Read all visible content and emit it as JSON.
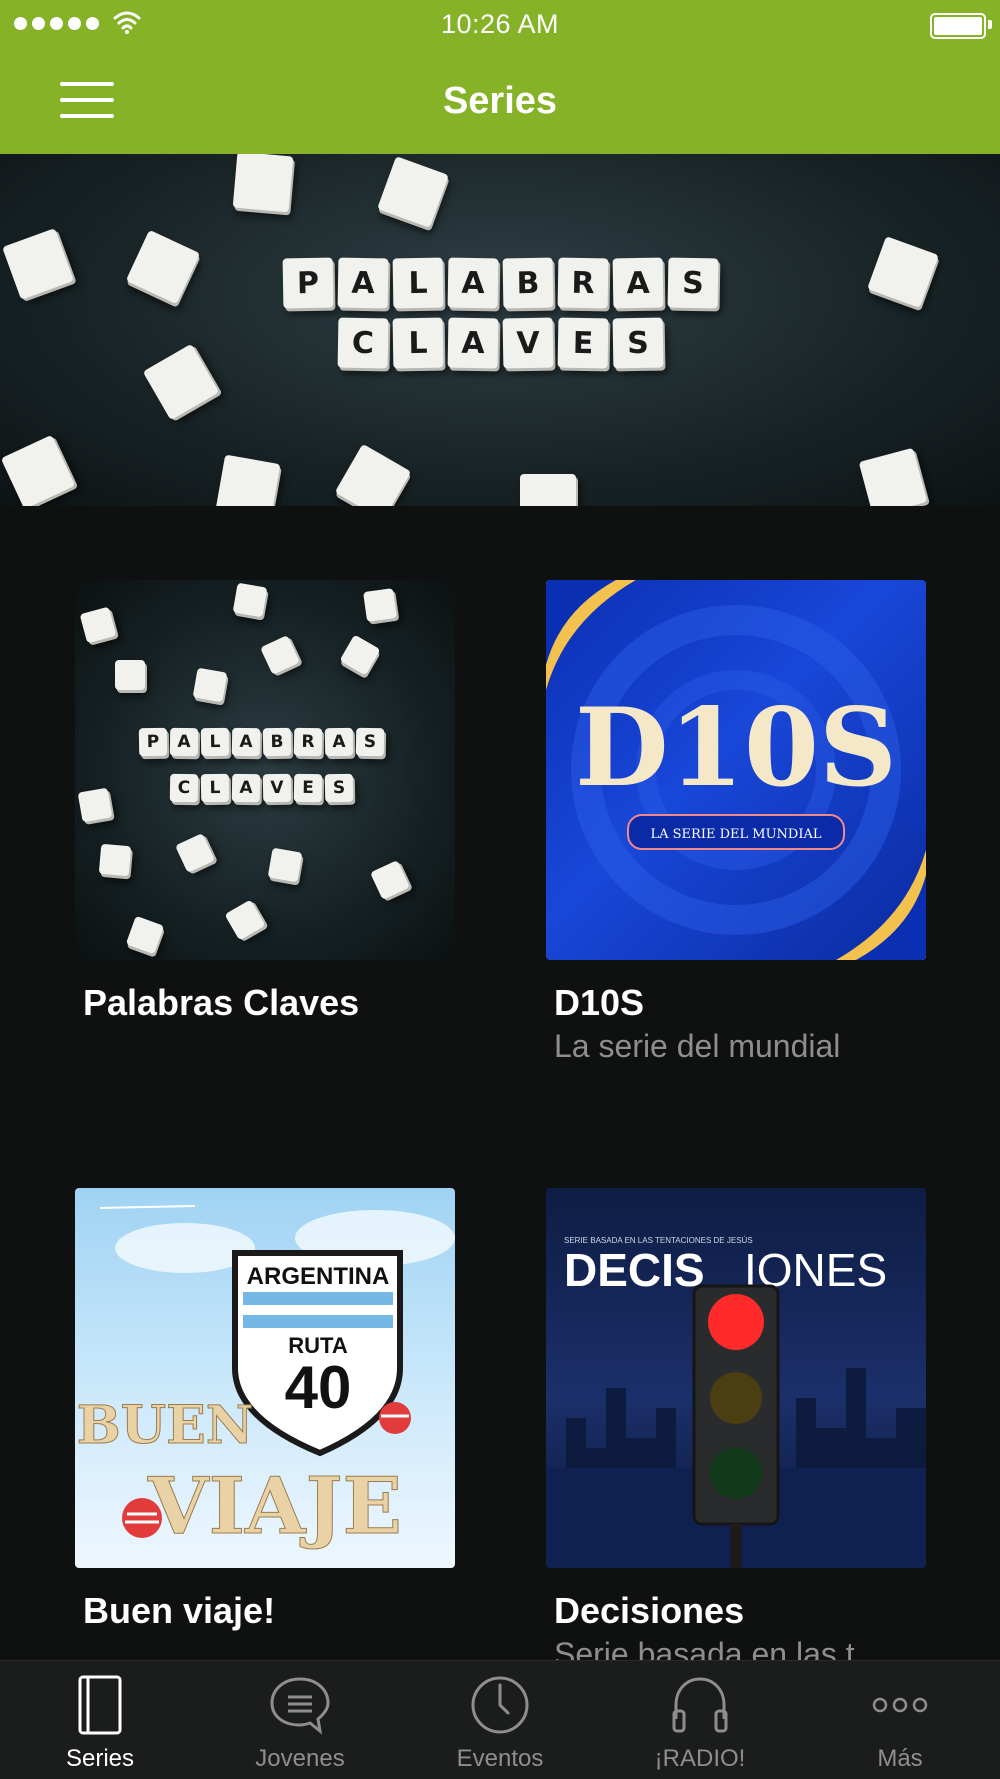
{
  "status_bar": {
    "time": "10:26 AM"
  },
  "header": {
    "title": "Series"
  },
  "banner": {
    "row1": [
      "P",
      "A",
      "L",
      "A",
      "B",
      "R",
      "A",
      "S"
    ],
    "row2": [
      "C",
      "L",
      "A",
      "V",
      "E",
      "S"
    ]
  },
  "cards": [
    {
      "title": "Palabras Claves",
      "subtitle": ""
    },
    {
      "title": "D10S",
      "subtitle": "La serie del mundial",
      "art_title": "D10S",
      "art_badge": "LA SERIE DEL MUNDIAL"
    },
    {
      "title": "Buen viaje!",
      "subtitle": "",
      "art_sign_top": "ARGENTINA",
      "art_sign_mid": "RUTA",
      "art_sign_num": "40",
      "art_word1": "BUEN",
      "art_word2": "VIAJE"
    },
    {
      "title": "Decisiones",
      "subtitle": "Serie basada en las t",
      "art_tagline": "SERIE BASADA EN LAS TENTACIONES DE JESÚS",
      "art_word_bold": "DECIS",
      "art_word_light": "IONES"
    }
  ],
  "tabs": [
    {
      "label": "Series",
      "icon": "book-icon",
      "active": true
    },
    {
      "label": "Jovenes",
      "icon": "chat-bubble-icon",
      "active": false
    },
    {
      "label": "Eventos",
      "icon": "clock-icon",
      "active": false
    },
    {
      "label": "¡RADIO!",
      "icon": "headphones-icon",
      "active": false
    },
    {
      "label": "Más",
      "icon": "more-dots-icon",
      "active": false
    }
  ],
  "colors": {
    "header": "#85b227",
    "background": "#0f1010",
    "tabbar": "#1b1c1c"
  }
}
